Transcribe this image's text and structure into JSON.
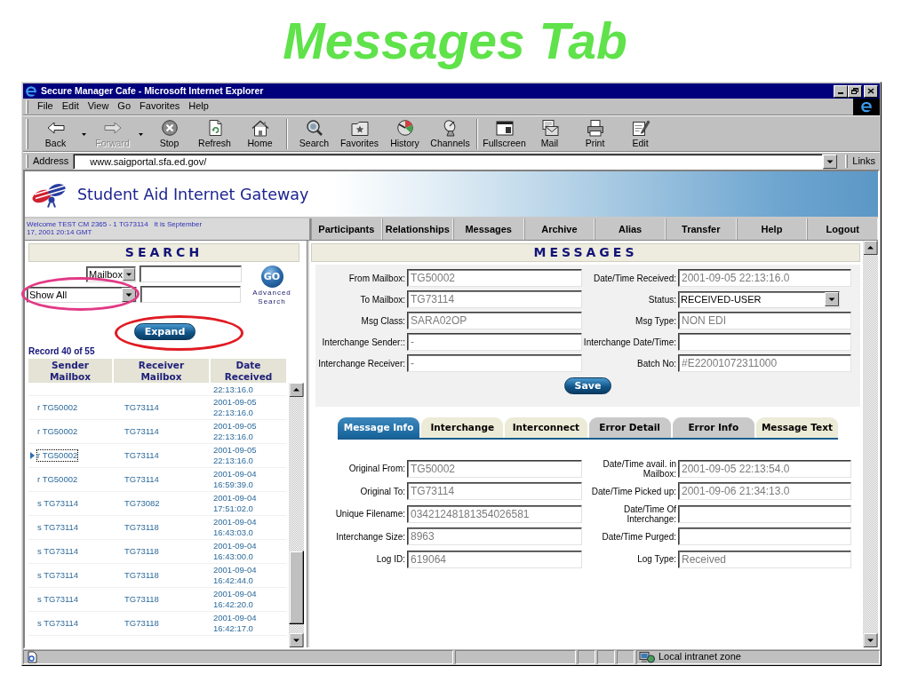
{
  "slide_title": "Messages Tab",
  "window": {
    "title": "Secure Manager Cafe - Microsoft Internet Explorer"
  },
  "menu": [
    "File",
    "Edit",
    "View",
    "Go",
    "Favorites",
    "Help"
  ],
  "toolbar": [
    {
      "buttons": [
        {
          "kind": "back",
          "label": "Back",
          "dropdown": true,
          "disabled": false
        },
        {
          "kind": "forward",
          "label": "Forward",
          "dropdown": true,
          "disabled": true
        },
        {
          "kind": "stop",
          "label": "Stop",
          "dropdown": false,
          "disabled": false
        },
        {
          "kind": "refresh",
          "label": "Refresh",
          "dropdown": false,
          "disabled": false
        },
        {
          "kind": "home",
          "label": "Home",
          "dropdown": false,
          "disabled": false
        }
      ]
    },
    {
      "buttons": [
        {
          "kind": "search",
          "label": "Search",
          "dropdown": false,
          "disabled": false
        },
        {
          "kind": "favorites",
          "label": "Favorites",
          "dropdown": false,
          "disabled": false
        },
        {
          "kind": "history",
          "label": "History",
          "dropdown": false,
          "disabled": false
        },
        {
          "kind": "channels",
          "label": "Channels",
          "dropdown": false,
          "disabled": false
        }
      ]
    },
    {
      "buttons": [
        {
          "kind": "fullscreen",
          "label": "Fullscreen",
          "dropdown": false,
          "disabled": false
        },
        {
          "kind": "mail",
          "label": "Mail",
          "dropdown": false,
          "disabled": false
        },
        {
          "kind": "print",
          "label": "Print",
          "dropdown": false,
          "disabled": false
        },
        {
          "kind": "edit",
          "label": "Edit",
          "dropdown": false,
          "disabled": false
        }
      ]
    }
  ],
  "address_bar": {
    "label": "Address",
    "value": "www.saigportal.sfa.ed.gov/",
    "links": "Links"
  },
  "banner": {
    "title": "Student Aid Internet Gateway"
  },
  "welcome": "Welcome TEST CM 2365 - 1 TG73114   It is September 17, 2001 20:14 GMT",
  "nav": [
    "Participants",
    "Relationships",
    "Messages",
    "Archive",
    "Alias",
    "Transfer",
    "Help",
    "Logout"
  ],
  "search": {
    "title": "SEARCH",
    "field_select": "Mailbox",
    "filter_select": {
      "value": "Show All",
      "highlighted": true
    },
    "go": "GO",
    "advanced": "Advanced Search",
    "expand": {
      "label": "Expand",
      "highlighted": true
    },
    "record": "Record 40 of 55"
  },
  "results": {
    "columns": [
      "Sender Mailbox",
      "Receiver Mailbox",
      "Date Received"
    ],
    "rows": [
      {
        "date_received": "22:13:16.0",
        "selected": false
      },
      {
        "sender": "r TG50002",
        "receiver": "TG73114",
        "date_received": "2001-09-05 22:13:16.0",
        "selected": false
      },
      {
        "sender": "r TG50002",
        "receiver": "TG73114",
        "date_received": "2001-09-05 22:13:16.0",
        "selected": false
      },
      {
        "sender": "r TG50002",
        "receiver": "TG73114",
        "date_received": "2001-09-05 22:13:16.0",
        "selected": true
      },
      {
        "sender": "r TG50002",
        "receiver": "TG73114",
        "date_received": "2001-09-04 16:59:39.0",
        "selected": false
      },
      {
        "sender": "s TG73114",
        "receiver": "TG73082",
        "date_received": "2001-09-04 17:51:02.0",
        "selected": false
      },
      {
        "sender": "s TG73114",
        "receiver": "TG73118",
        "date_received": "2001-09-04 16:43:03.0",
        "selected": false
      },
      {
        "sender": "s TG73114",
        "receiver": "TG73118",
        "date_received": "2001-09-04 16:43:00.0",
        "selected": false
      },
      {
        "sender": "s TG73114",
        "receiver": "TG73118",
        "date_received": "2001-09-04 16:42:44.0",
        "selected": false
      },
      {
        "sender": "s TG73114",
        "receiver": "TG73118",
        "date_received": "2001-09-04 16:42:20.0",
        "selected": false
      },
      {
        "sender": "s TG73114",
        "receiver": "TG73118",
        "date_received": "2001-09-04 16:42:17.0",
        "selected": false
      }
    ]
  },
  "messages": {
    "title": "MESSAGES",
    "fields": [
      [
        {
          "label": "From Mailbox:",
          "value": "TG50002",
          "kind": "text"
        },
        {
          "label": "Date/Time Received:",
          "value": "2001-09-05 22:13:16.0",
          "kind": "text"
        }
      ],
      [
        {
          "label": "To Mailbox:",
          "value": "TG73114",
          "kind": "text"
        },
        {
          "label": "Status:",
          "value": "RECEIVED-USER",
          "kind": "select"
        }
      ],
      [
        {
          "label": "Msg Class:",
          "value": "SARA02OP",
          "kind": "text"
        },
        {
          "label": "Msg Type:",
          "value": "NON EDI",
          "kind": "text"
        }
      ],
      [
        {
          "label": "Interchange Sender::",
          "value": "-",
          "kind": "text"
        },
        {
          "label": "Interchange Date/Time:",
          "kind": "text"
        }
      ],
      [
        {
          "label": "Interchange Receiver:",
          "value": "-",
          "kind": "text"
        },
        {
          "label": "Batch No:",
          "value": "#E22001072311000",
          "kind": "text"
        }
      ]
    ],
    "save": "Save",
    "tabs": [
      {
        "label": "Message Info",
        "selected": true,
        "disabled": false
      },
      {
        "label": "Interchange",
        "selected": false,
        "disabled": false
      },
      {
        "label": "Interconnect",
        "selected": false,
        "disabled": false
      },
      {
        "label": "Error Detail",
        "selected": false,
        "disabled": true
      },
      {
        "label": "Error Info",
        "selected": false,
        "disabled": true
      },
      {
        "label": "Message Text",
        "selected": false,
        "disabled": false
      }
    ],
    "detail_fields": [
      [
        {
          "label": "Original From:",
          "value": "TG50002",
          "kind": "text"
        },
        {
          "label": "Date/Time avail. in Mailbox:",
          "value": "2001-09-05 22:13:54.0",
          "kind": "text"
        }
      ],
      [
        {
          "label": "Original To:",
          "value": "TG73114",
          "kind": "text"
        },
        {
          "label": "Date/Time Picked up:",
          "value": "2001-09-06 21:34:13.0",
          "kind": "text"
        }
      ],
      [
        {
          "label": "Unique Filename:",
          "value": "03421248181354026581",
          "kind": "text"
        },
        {
          "label": "Date/Time Of Interchange:",
          "kind": "text"
        }
      ],
      [
        {
          "label": "Interchange Size:",
          "value": "8963",
          "kind": "text"
        },
        {
          "label": "Date/Time Purged:",
          "kind": "text"
        }
      ],
      [
        {
          "label": "Log ID:",
          "value": "619064",
          "kind": "text"
        },
        {
          "label": "Log Type:",
          "value": "Received",
          "kind": "text"
        }
      ]
    ]
  },
  "status_bar": {
    "zone": "Local intranet zone"
  }
}
